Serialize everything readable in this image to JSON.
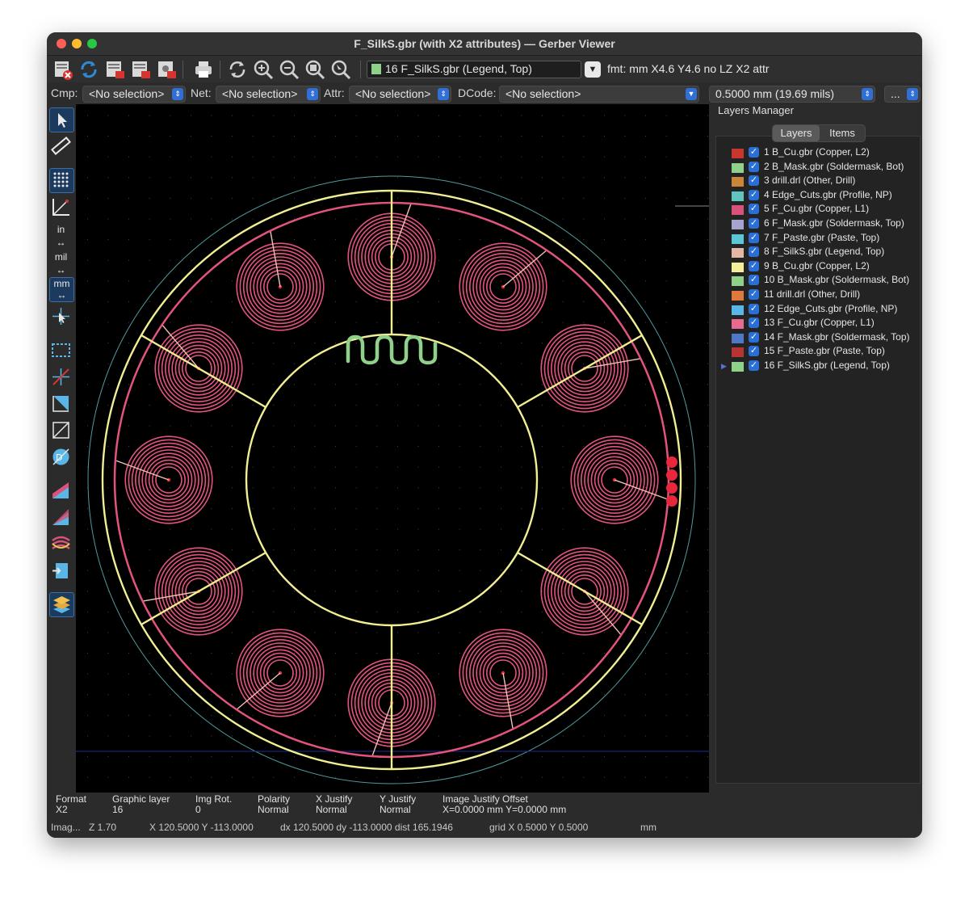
{
  "window": {
    "title": "F_SilkS.gbr (with X2 attributes) — Gerber Viewer"
  },
  "toolbar": {
    "active_layer_label": "16 F_SilkS.gbr (Legend, Top)",
    "active_layer_color": "#8fd08a",
    "format_text": "fmt: mm X4.6 Y4.6 no LZ X2 attr",
    "icons": [
      "erase-layer-icon",
      "reload-icon",
      "open-gerber-icon",
      "open-drill-icon",
      "open-zip-icon",
      "print-icon",
      "redraw-icon",
      "zoom-in-icon",
      "zoom-out-icon",
      "zoom-fit-icon",
      "zoom-selection-icon"
    ]
  },
  "filters": {
    "cmp_label": "Cmp:",
    "cmp_value": "<No selection>",
    "net_label": "Net:",
    "net_value": "<No selection>",
    "attr_label": "Attr:",
    "attr_value": "<No selection>",
    "dcode_label": "DCode:",
    "dcode_value": "<No selection>",
    "grid_value": "0.5000 mm (19.69 mils)",
    "more_value": "..."
  },
  "left_tools": [
    "select-arrow-icon",
    "measure-ruler-icon",
    "grid-toggle-icon",
    "polar-coords-icon",
    "units-inch-icon",
    "units-mil-icon",
    "units-mm-icon",
    "cursor-crosshair-icon",
    "zone-outline-icon",
    "flashed-items-sketch-icon",
    "polygon-sketch-icon",
    "lines-sketch-icon",
    "dcodes-icon",
    "negative-objects-icon",
    "diff-mode-icon",
    "transparency-icon",
    "toggle-layers-icon",
    "layers-manager-icon"
  ],
  "tool_labels": {
    "in": "in",
    "mil": "mil",
    "mm": "mm"
  },
  "layers_panel": {
    "title": "Layers Manager",
    "tab_layers": "Layers",
    "tab_items": "Items",
    "layers": [
      {
        "label": "1 B_Cu.gbr (Copper, L2)",
        "color": "#c8362f"
      },
      {
        "label": "2 B_Mask.gbr (Soldermask, Bot)",
        "color": "#8fd08a"
      },
      {
        "label": "3 drill.drl (Other, Drill)",
        "color": "#c98838"
      },
      {
        "label": "4 Edge_Cuts.gbr (Profile, NP)",
        "color": "#5fc4bf"
      },
      {
        "label": "5 F_Cu.gbr (Copper, L1)",
        "color": "#d8527a"
      },
      {
        "label": "6 F_Mask.gbr (Soldermask, Top)",
        "color": "#a6a3cf"
      },
      {
        "label": "7 F_Paste.gbr (Paste, Top)",
        "color": "#5bc7d6"
      },
      {
        "label": "8 F_SilkS.gbr (Legend, Top)",
        "color": "#e2b7a6"
      },
      {
        "label": "9 B_Cu.gbr (Copper, L2)",
        "color": "#f2ee9a"
      },
      {
        "label": "10 B_Mask.gbr (Soldermask, Bot)",
        "color": "#8fd08a"
      },
      {
        "label": "11 drill.drl (Other, Drill)",
        "color": "#e07a3a"
      },
      {
        "label": "12 Edge_Cuts.gbr (Profile, NP)",
        "color": "#5ab6e6"
      },
      {
        "label": "13 F_Cu.gbr (Copper, L1)",
        "color": "#e86a8e"
      },
      {
        "label": "14 F_Mask.gbr (Soldermask, Top)",
        "color": "#4f78c8"
      },
      {
        "label": "15 F_Paste.gbr (Paste, Top)",
        "color": "#b83434"
      },
      {
        "label": "16 F_SilkS.gbr (Legend, Top)",
        "color": "#8fd08a"
      }
    ]
  },
  "info": {
    "format_label": "Format",
    "format_value": "X2",
    "graphic_layer_label": "Graphic layer",
    "graphic_layer_value": "16",
    "img_rot_label": "Img Rot.",
    "img_rot_value": "0",
    "polarity_label": "Polarity",
    "polarity_value": "Normal",
    "xjust_label": "X Justify",
    "xjust_value": "Normal",
    "yjust_label": "Y Justify",
    "yjust_value": "Normal",
    "offset_label": "Image Justify Offset",
    "offset_value": "X=0.0000 mm Y=0.0000 mm"
  },
  "status": {
    "mode": "Imag...",
    "zoom": "Z 1.70",
    "xy": "X 120.5000  Y -113.0000",
    "delta": "dx 120.5000  dy -113.0000  dist 165.1946",
    "grid": "grid X 0.5000  Y 0.5000",
    "units": "mm"
  },
  "colors": {
    "copper_trace": "#e3547d",
    "silkscreen": "#f1ee93",
    "board_outline": "#4f9a9a",
    "legend_logo": "#8fd08a",
    "pad": "#e8283a"
  }
}
